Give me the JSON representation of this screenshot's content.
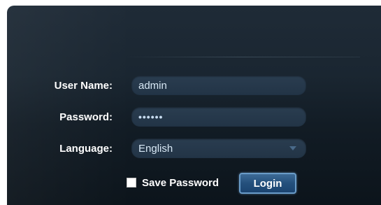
{
  "form": {
    "username_label": "User Name:",
    "username_value": "admin",
    "password_label": "Password:",
    "password_value": "••••••",
    "language_label": "Language:",
    "language_value": "English",
    "save_password_label": "Save Password",
    "save_password_checked": false,
    "login_label": "Login"
  },
  "colors": {
    "panel_background": "#1a2631",
    "field_background": "#253848",
    "field_text": "#d8e8f5",
    "button_background": "#24507c",
    "button_border": "#6a9cc8",
    "label_text": "#ffffff"
  }
}
